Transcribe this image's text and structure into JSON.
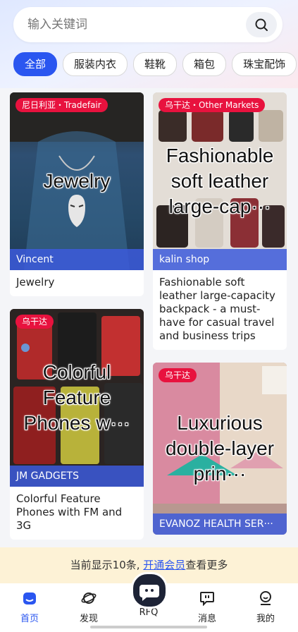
{
  "search": {
    "placeholder": "输入关键词"
  },
  "categories": [
    "全部",
    "服装内衣",
    "鞋靴",
    "箱包",
    "珠宝配饰"
  ],
  "cards": {
    "jewelry": {
      "badge": "尼日利亚・Tradefair",
      "overlay": "Jewelry",
      "shop": "Vincent",
      "title": "Jewelry"
    },
    "phones": {
      "badge": "乌干达",
      "overlay": "Colorful Feature Phones w···",
      "shop": "JM GADGETS",
      "title": "Colorful Feature Phones with FM and 3G"
    },
    "backpack": {
      "badge": "乌干达・Other Markets",
      "overlay": "Fashionable soft leather large-cap···",
      "shop": "kalin shop",
      "title": "Fashionable soft leather large-capacity backpack - a must-have for casual travel and business trips"
    },
    "curtain": {
      "badge": "乌干达",
      "overlay": "Luxurious double-layer prin···",
      "shop": "EVANOZ  HEALTH  SER···"
    }
  },
  "membership": {
    "prefix": "当前显示10条, ",
    "link": "开通会员",
    "suffix": "查看更多"
  },
  "tabs": {
    "home": "首页",
    "discover": "发现",
    "rfq": "RFQ",
    "messages": "消息",
    "mine": "我的"
  },
  "colors": {
    "accent": "#2a56f0",
    "badge": "#e8123e"
  }
}
